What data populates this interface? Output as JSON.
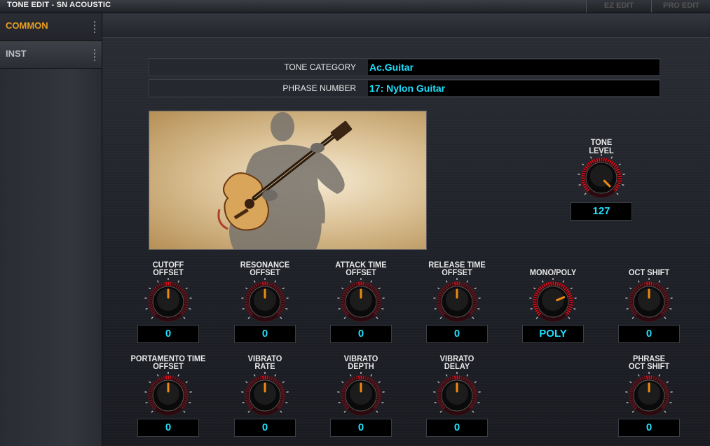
{
  "window": {
    "title": "TONE EDIT - SN ACOUSTIC"
  },
  "modes": {
    "ez_edit": "EZ EDIT",
    "pro_edit": "PRO EDIT"
  },
  "sidebar": {
    "items": [
      {
        "label": "COMMON",
        "active": true
      },
      {
        "label": "INST",
        "active": false
      }
    ]
  },
  "params": {
    "tone_category": {
      "label": "TONE CATEGORY",
      "value": "Ac.Guitar"
    },
    "phrase_number": {
      "label": "PHRASE NUMBER",
      "value": "17: Nylon Guitar"
    }
  },
  "tone_level": {
    "label1": "TONE",
    "label2": "LEVEL",
    "value": "127",
    "level": 1.0
  },
  "knobs_row1": [
    {
      "label1": "CUTOFF",
      "label2": "OFFSET",
      "value": "0"
    },
    {
      "label1": "RESONANCE",
      "label2": "OFFSET",
      "value": "0"
    },
    {
      "label1": "ATTACK TIME",
      "label2": "OFFSET",
      "value": "0"
    },
    {
      "label1": "RELEASE TIME",
      "label2": "OFFSET",
      "value": "0"
    },
    {
      "label1": "",
      "label2": "MONO/POLY",
      "value": "POLY"
    },
    {
      "label1": "",
      "label2": "OCT SHIFT",
      "value": "0"
    }
  ],
  "knobs_row2": [
    {
      "label1": "PORTAMENTO TIME",
      "label2": "OFFSET",
      "value": "0"
    },
    {
      "label1": "VIBRATO",
      "label2": "RATE",
      "value": "0"
    },
    {
      "label1": "VIBRATO",
      "label2": "DEPTH",
      "value": "0"
    },
    {
      "label1": "VIBRATO",
      "label2": "DELAY",
      "value": "0"
    },
    {
      "label1": "PHRASE",
      "label2": "OCT SHIFT",
      "value": "0"
    }
  ],
  "colors": {
    "accent": "#e8a020",
    "value_text": "#1fe0ff",
    "knob_ring": "#e0101e",
    "pointer": "#f08a10"
  }
}
